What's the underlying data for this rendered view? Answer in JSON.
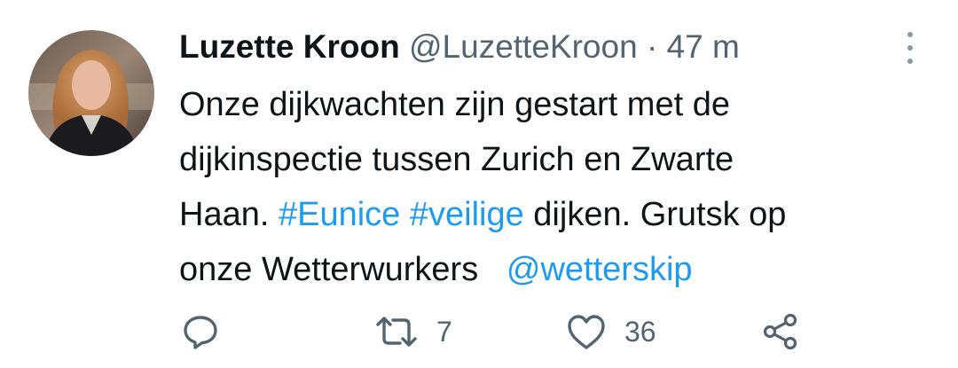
{
  "tweet": {
    "author": {
      "display_name": "Luzette Kroon",
      "handle": "@LuzetteKroon",
      "avatar_icon": "profile-photo"
    },
    "separator": "·",
    "time": "47 m",
    "text": {
      "line1": "Onze dijkwachten zijn gestart met de",
      "line2": "dijkinspectie tussen Zurich en Zwarte",
      "line3_prefix": "Haan.",
      "hashtag1": "#Eunice",
      "hashtag2": "#veilige",
      "line3_suffix": "dijken. Grutsk op",
      "line4_prefix": "onze Wetterwurkers",
      "mention": "@wetterskip"
    },
    "actions": {
      "reply_icon": "reply-icon",
      "retweet_icon": "retweet-icon",
      "retweet_count": "7",
      "like_icon": "heart-icon",
      "like_count": "36",
      "share_icon": "share-icon"
    }
  },
  "colors": {
    "text": "#0f1419",
    "secondary": "#536471",
    "link": "#1d9bf0",
    "background": "#ffffff"
  }
}
